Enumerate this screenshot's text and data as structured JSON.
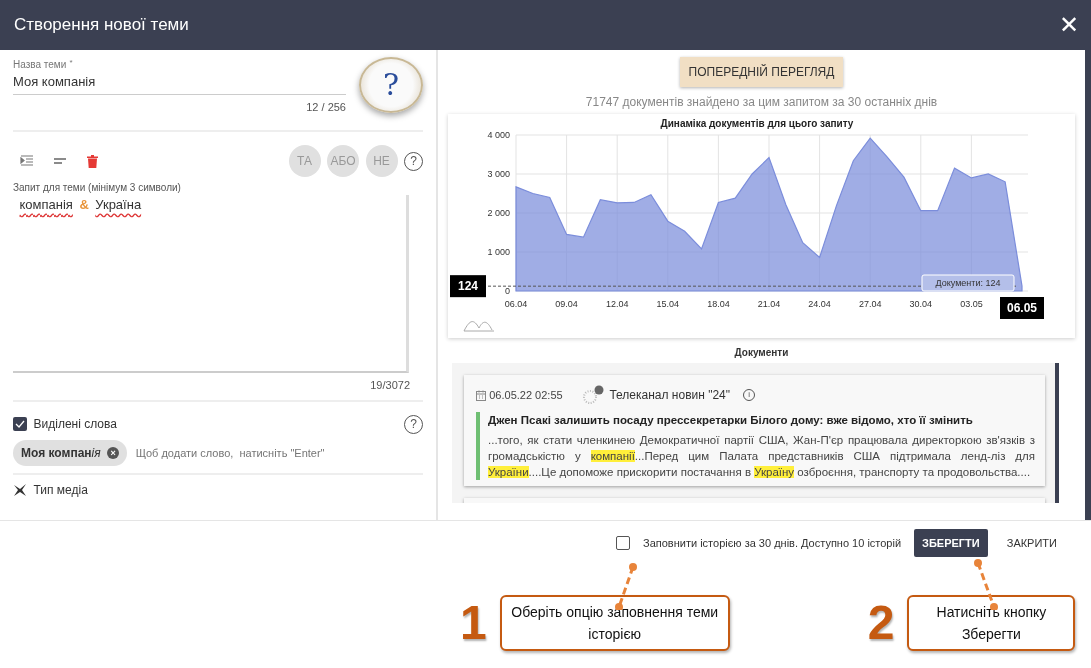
{
  "window": {
    "title": "Створення нової теми",
    "close": "✕"
  },
  "theme_name": {
    "label": "Назва теми",
    "required_mark": "*",
    "value": "Моя компанія",
    "counter": "12 / 256",
    "help_image": "?"
  },
  "operators": [
    {
      "label": "ТА"
    },
    {
      "label": "АБО"
    },
    {
      "label": "НЕ"
    }
  ],
  "operators_help": "?",
  "query": {
    "label": "Запит для теми (мінімум 3 символи)",
    "tokens": [
      {
        "kind": "word",
        "text": "компанія"
      },
      {
        "kind": "operator",
        "text": "&"
      },
      {
        "kind": "word",
        "text": "Україна"
      }
    ],
    "counter": "19/3072"
  },
  "highlighted_words": {
    "label": "Виділені слова",
    "checked": true,
    "help": "?",
    "chips": [
      {
        "text": "Моя компан",
        "suffix": "ія",
        "remove": "×"
      }
    ],
    "placeholder": "Щоб додати слово,  натисніть \"Enter\""
  },
  "media_type": {
    "label": "Тип медіа"
  },
  "preview_button": "ПОПЕРЕДНІЙ ПЕРЕГЛЯД",
  "found_text": "71747 документів знайдено за цим запитом за 30 останніх днів",
  "chart": {
    "hover": {
      "y_label": "124",
      "tooltip": "Документи: 124"
    },
    "chart_data": {
      "type": "area",
      "title": "Динаміка документів для цього запиту",
      "grid": true,
      "categories": [
        "06.04",
        null,
        null,
        "09.04",
        null,
        null,
        "12.04",
        null,
        null,
        "15.04",
        null,
        null,
        "18.04",
        null,
        null,
        "21.04",
        null,
        null,
        "24.04",
        null,
        null,
        "27.04",
        null,
        null,
        "30.04",
        null,
        null,
        "03.05",
        null,
        null,
        "06.05"
      ],
      "series": [
        {
          "color": "#7b8ddb",
          "values": [
            2670,
            2500,
            2400,
            1450,
            1380,
            2340,
            2260,
            2270,
            2470,
            1790,
            1530,
            1080,
            2270,
            2380,
            3000,
            3420,
            2210,
            1240,
            860,
            2190,
            3340,
            3920,
            3440,
            2920,
            2060,
            2060,
            3150,
            2900,
            3000,
            2800,
            124
          ]
        }
      ],
      "ylim": [
        0,
        4000
      ],
      "yticks": [
        {
          "value": 0,
          "label": "0"
        },
        {
          "value": 1000,
          "label": "1 000"
        },
        {
          "value": 2000,
          "label": "2 000"
        },
        {
          "value": 3000,
          "label": "3 000"
        },
        {
          "value": 4000,
          "label": "4 000"
        }
      ],
      "ref_lines": [
        {
          "axis": "y",
          "value": 124
        }
      ]
    }
  },
  "documents": {
    "title": "Документи",
    "items": [
      {
        "date": "06.05.22 02:55",
        "source": "Телеканал новин \"24\"",
        "info": "i",
        "headline": "Джен Псакі залишить посаду прессекретарки Білого дому: вже відомо, хто її змінить",
        "snippet": [
          {
            "text": "...того, як стати членкинею Демократичної партії США, Жан-П'єр працювала директоркою зв'язків з громадськістю у ",
            "highlight": false
          },
          {
            "text": "компанії",
            "highlight": true
          },
          {
            "text": "...Перед цим Палата представників США підтримала ленд-ліз для ",
            "highlight": false
          },
          {
            "text": "України",
            "highlight": true
          },
          {
            "text": "....Це допоможе прискорити постачання в ",
            "highlight": false
          },
          {
            "text": "Україну",
            "highlight": true
          },
          {
            "text": " озброєння, транспорту та продовольства....",
            "highlight": false
          }
        ]
      }
    ]
  },
  "footer": {
    "history_checkbox": {
      "label": "Заповнити історією за 30 днів. Доступно 10 історій",
      "checked": false
    },
    "save": "ЗБЕРЕГТИ",
    "close": "ЗАКРИТИ"
  },
  "callouts": [
    {
      "number": "1",
      "text": "Оберіть опцію заповнення теми історією"
    },
    {
      "number": "2",
      "text": "Натисніть кнопку Зберегти"
    }
  ]
}
